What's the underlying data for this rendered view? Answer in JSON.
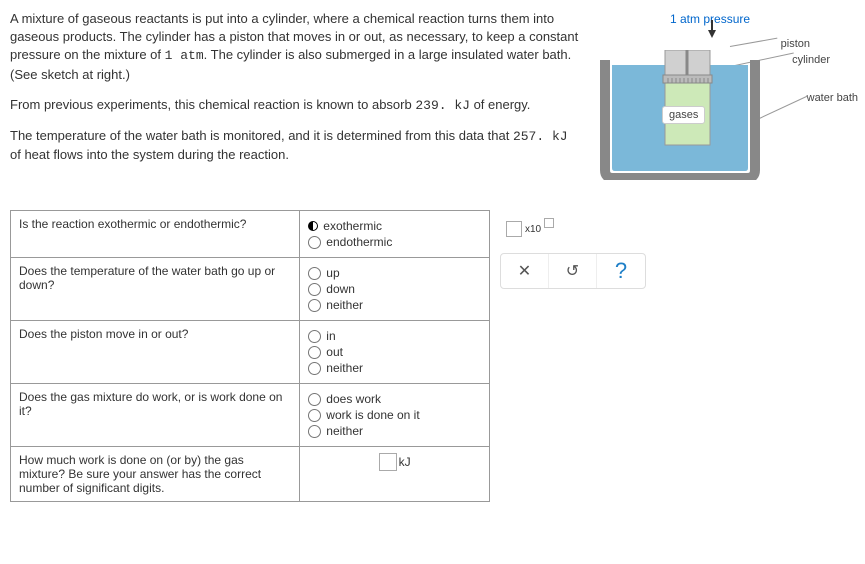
{
  "problem": {
    "p1": "A mixture of gaseous reactants is put into a cylinder, where a chemical reaction turns them into gaseous products. The cylinder has a piston that moves in or out, as necessary, to keep a constant pressure on the mixture of ",
    "pressure_val": "1 atm",
    "p1b": ". The cylinder is also submerged in a large insulated water bath. (See sketch at right.)",
    "p2a": "From previous experiments, this chemical reaction is known to absorb ",
    "absorb_val": "239. kJ",
    "p2b": " of energy.",
    "p3a": "The temperature of the water bath is monitored, and it is determined from this data that ",
    "heat_val": "257. kJ",
    "p3b": " of heat flows into the system during the reaction."
  },
  "diagram": {
    "pressure": "1 atm pressure",
    "piston": "piston",
    "cylinder": "cylinder",
    "waterbath": "water bath",
    "gases": "gases"
  },
  "questions": {
    "q1": "Is the reaction exothermic or endothermic?",
    "q1_opts": {
      "a": "exothermic",
      "b": "endothermic"
    },
    "q2": "Does the temperature of the water bath go up or down?",
    "q2_opts": {
      "a": "up",
      "b": "down",
      "c": "neither"
    },
    "q3": "Does the piston move in or out?",
    "q3_opts": {
      "a": "in",
      "b": "out",
      "c": "neither"
    },
    "q4": "Does the gas mixture do work, or is work done on it?",
    "q4_opts": {
      "a": "does work",
      "b": "work is done on it",
      "c": "neither"
    },
    "q5": "How much work is done on (or by) the gas mixture? Be sure your answer has the correct number of significant digits.",
    "q5_unit": "kJ"
  },
  "controls": {
    "x10": "x10",
    "close": "✕",
    "redo": "↺",
    "help": "?"
  }
}
